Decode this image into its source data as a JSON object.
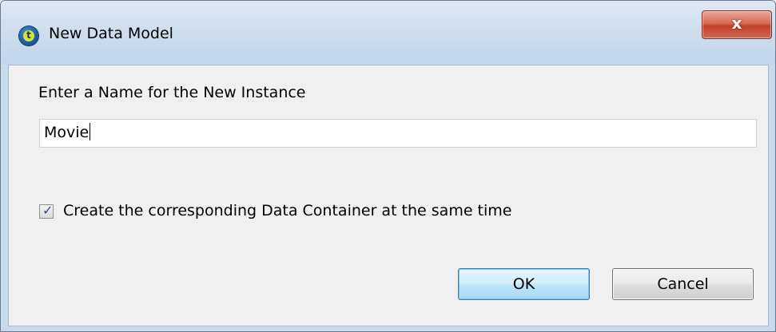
{
  "window": {
    "title": "New Data Model",
    "app_icon": "talend-logo-icon",
    "close_symbol": "x"
  },
  "form": {
    "prompt_label": "Enter a Name for the New Instance",
    "name_value": "Movie",
    "create_container_checked": true,
    "create_container_label": "Create the corresponding Data Container at the same time"
  },
  "buttons": {
    "ok_label": "OK",
    "cancel_label": "Cancel"
  },
  "colors": {
    "titlebar": "#cfdeee",
    "close_button": "#c0402d",
    "ok_button_border": "#3c7fb1"
  }
}
